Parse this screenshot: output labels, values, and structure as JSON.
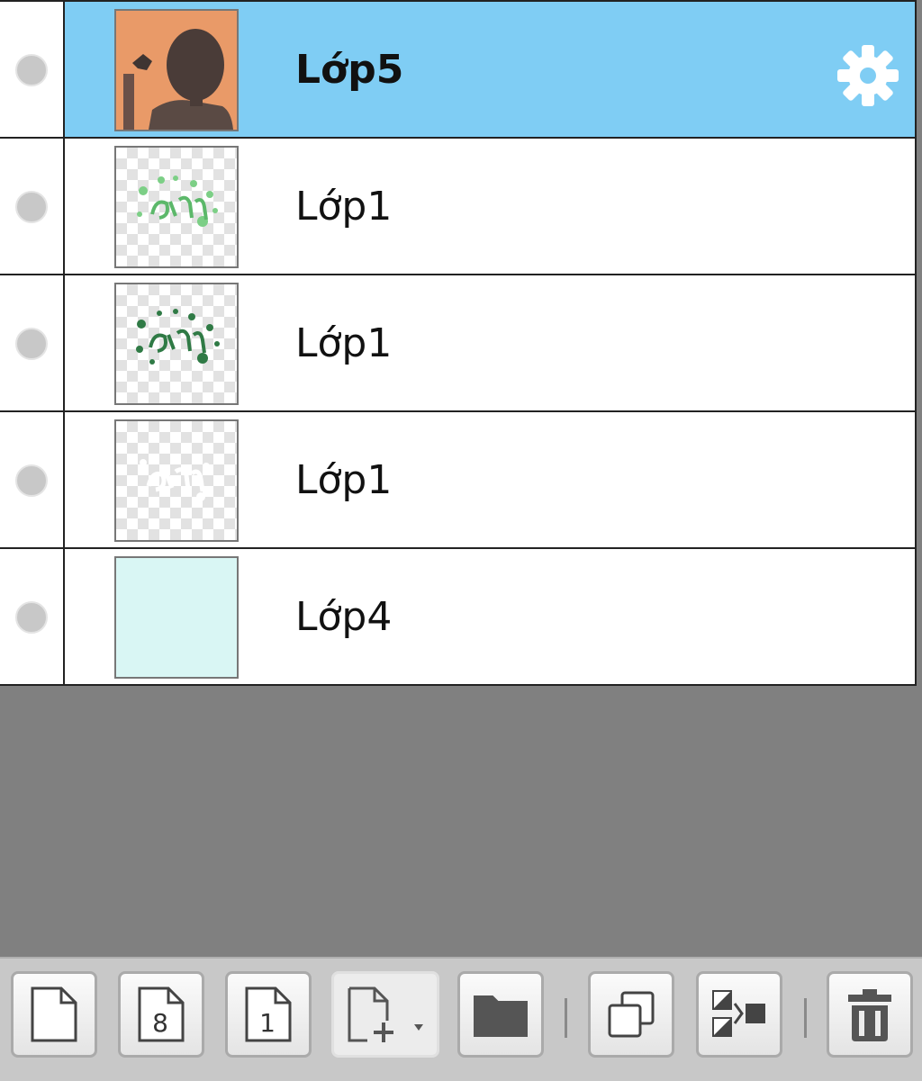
{
  "layers": [
    {
      "name": "Lớp5",
      "selected": true,
      "thumbnail": "photo-silhouette"
    },
    {
      "name": "Lớp1",
      "selected": false,
      "thumbnail": "transparent-green-art"
    },
    {
      "name": "Lớp1",
      "selected": false,
      "thumbnail": "transparent-darkgreen-art"
    },
    {
      "name": "Lớp1",
      "selected": false,
      "thumbnail": "transparent-white-art"
    },
    {
      "name": "Lớp4",
      "selected": false,
      "thumbnail": "solid-mint"
    }
  ],
  "colors": {
    "selected_row": "#7fcdf4",
    "empty_area": "#808080",
    "toolbar": "#c8c8c8",
    "layer4_fill": "#d9f6f4",
    "photo_bg": "#e99a68"
  },
  "toolbar": {
    "buttons": [
      {
        "icon": "new-layer-icon"
      },
      {
        "icon": "new-8bit-layer-icon"
      },
      {
        "icon": "new-1bit-layer-icon"
      },
      {
        "icon": "add-layer-menu-icon"
      },
      {
        "icon": "new-folder-icon"
      },
      {
        "icon": "duplicate-layer-icon"
      },
      {
        "icon": "merge-layer-icon"
      },
      {
        "icon": "delete-layer-icon"
      }
    ],
    "eight_glyph": "8",
    "one_glyph": "1"
  }
}
